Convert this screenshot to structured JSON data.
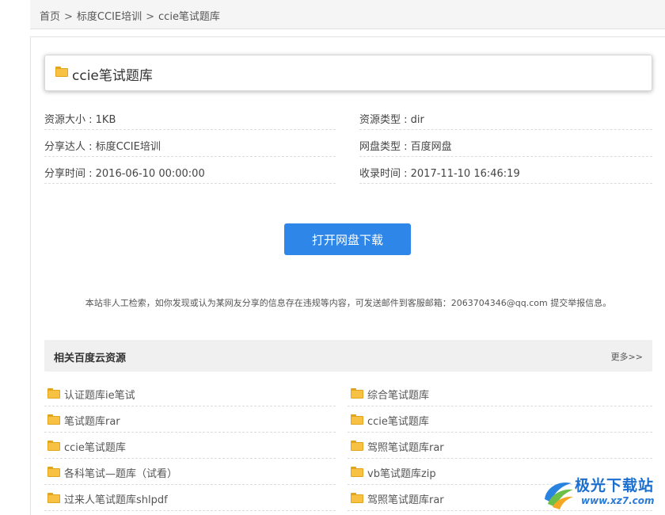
{
  "breadcrumb": {
    "home": "首页",
    "sep1": ">",
    "category": "标度CCIE培训",
    "sep2": ">",
    "current": "ccie笔试题库"
  },
  "resource": {
    "title": "ccie笔试题库",
    "size": "资源大小 : 1KB",
    "type": "资源类型 : dir",
    "sharer": "分享达人 : 标度CCIE培训",
    "disk_type": "网盘类型 : 百度网盘",
    "share_time": "分享时间 : 2016-06-10 00:00:00",
    "collect_time": "收录时间 : 2017-11-10 16:46:19"
  },
  "download_button": "打开网盘下载",
  "notice": "本站非人工检索，如你发现或认为某网友分享的信息存在违规等内容，可发送邮件到客服邮箱：2063704346@qq.com 提交举报信息。",
  "related": {
    "title": "相关百度云资源",
    "more": "更多>>",
    "left": [
      "认证题库ie笔试",
      "笔试题库rar",
      "ccie笔试题库",
      "各科笔试—题库（试看）",
      "过来人笔试题库shlpdf"
    ],
    "right": [
      "综合笔试题库",
      "ccie笔试题库",
      "驾照笔试题库rar",
      "vb笔试题库zip",
      "驾照笔试题库rar"
    ]
  },
  "watermark": {
    "name": "极光下载站",
    "url": "www.xz7.com"
  },
  "colors": {
    "accent": "#2e86e8",
    "folder": "#f7c244"
  }
}
